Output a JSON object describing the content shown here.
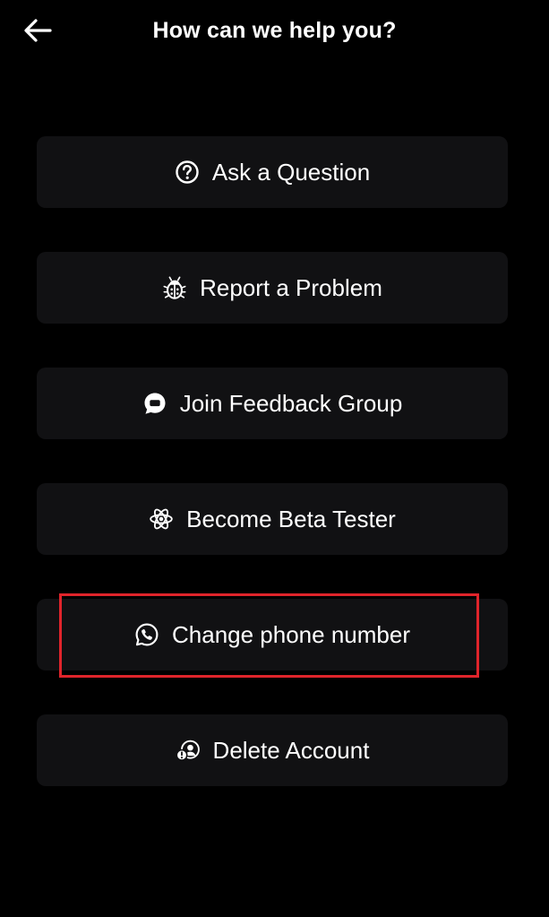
{
  "header": {
    "back_icon": "arrow-left-icon",
    "title": "How can we help you?"
  },
  "menu": {
    "items": [
      {
        "label": "Ask a Question",
        "icon": "question-circle-icon"
      },
      {
        "label": "Report a Problem",
        "icon": "bug-icon"
      },
      {
        "label": "Join Feedback Group",
        "icon": "chat-bubble-icon"
      },
      {
        "label": "Become Beta Tester",
        "icon": "atom-icon"
      },
      {
        "label": "Change phone number",
        "icon": "phone-circle-icon"
      },
      {
        "label": "Delete Account",
        "icon": "user-alert-icon"
      }
    ]
  },
  "colors": {
    "background": "#000000",
    "item_background": "#111113",
    "text": "#ffffff",
    "highlight_border": "#e0242b"
  }
}
